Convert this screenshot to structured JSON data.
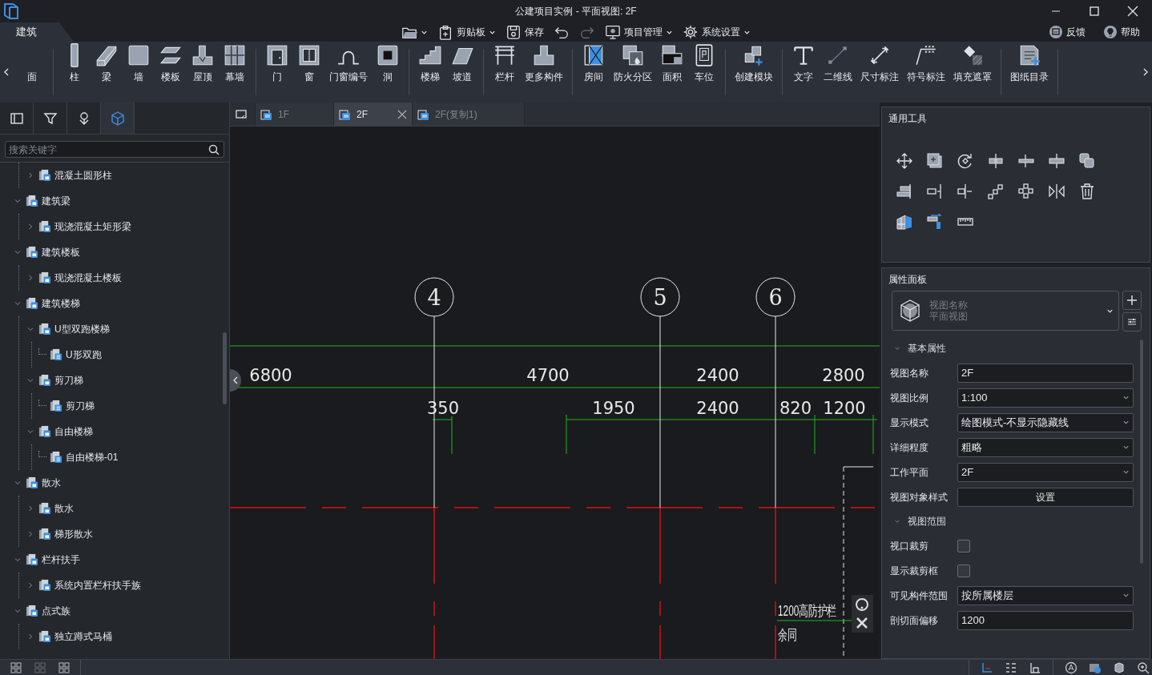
{
  "window": {
    "title": "公建项目实例 - 平面视图: 2F"
  },
  "ribbon_tabs": [
    {
      "label": "建筑",
      "selected": true
    }
  ],
  "quick_toolbar": [
    {
      "dropdown": true,
      "disabled": false
    },
    {
      "label": "剪贴板",
      "dropdown": true,
      "disabled": false
    },
    {
      "label": "保存",
      "dropdown": false,
      "disabled": false
    },
    {
      "dropdown": false,
      "disabled": false
    },
    {
      "dropdown": false,
      "disabled": true
    },
    {
      "label": "项目管理",
      "dropdown": true,
      "disabled": false
    },
    {
      "label": "系统设置",
      "dropdown": true,
      "disabled": false
    }
  ],
  "help_links": [
    "反馈",
    "帮助"
  ],
  "ribbon": [
    {
      "tools": [
        "面"
      ]
    },
    {
      "tools": [
        "柱",
        "梁",
        "墙",
        "楼板",
        "屋顶",
        "幕墙"
      ]
    },
    {
      "tools": [
        "门",
        "窗",
        "门窗编号",
        "洞"
      ]
    },
    {
      "tools": [
        "楼梯",
        "坡道"
      ]
    },
    {
      "tools": [
        "栏杆",
        "更多构件"
      ]
    },
    {
      "tools": [
        "房间",
        "防火分区",
        "面积",
        "车位"
      ]
    },
    {
      "tools": [
        "创建模块"
      ]
    },
    {
      "tools": [
        "文字",
        "二维线",
        "尺寸标注",
        "符号标注",
        "填充遮罩"
      ]
    },
    {
      "tools": [
        "图纸目录"
      ]
    }
  ],
  "left_panel": {
    "tabs": [
      {
        "selected": false
      },
      {
        "selected": false
      },
      {
        "selected": false
      },
      {
        "selected": true
      }
    ],
    "search": {
      "placeholder": "搜索关键字"
    },
    "tree": [
      {
        "children": [
          {
            "label": "混凝土圆形柱",
            "expanded": false
          }
        ]
      },
      {
        "label": "建筑梁",
        "expanded": true,
        "children": [
          {
            "label": "现浇混凝土矩形梁",
            "expanded": false
          }
        ]
      },
      {
        "label": "建筑楼板",
        "expanded": true,
        "children": [
          {
            "label": "现浇混凝土楼板",
            "expanded": false
          }
        ]
      },
      {
        "label": "建筑楼梯",
        "expanded": true,
        "children": [
          {
            "label": "U型双跑楼梯",
            "expanded": true,
            "children": [
              {
                "label": "U形双跑"
              }
            ]
          },
          {
            "label": "剪刀梯",
            "expanded": true,
            "children": [
              {
                "label": "剪刀梯"
              }
            ]
          },
          {
            "label": "自由楼梯",
            "expanded": true,
            "children": [
              {
                "label": "自由楼梯-01"
              }
            ]
          }
        ]
      },
      {
        "label": "散水",
        "expanded": true,
        "children": [
          {
            "label": "散水",
            "expanded": false
          },
          {
            "label": "梯形散水",
            "expanded": false
          }
        ]
      },
      {
        "label": "栏杆扶手",
        "expanded": true,
        "children": [
          {
            "label": "系统内置栏杆扶手族",
            "expanded": false
          }
        ]
      },
      {
        "label": "点式族",
        "expanded": true,
        "children": [
          {
            "label": "独立蹲式马桶",
            "expanded": false
          }
        ]
      }
    ]
  },
  "document_tabs": [
    {
      "label": "1F",
      "selected": false
    },
    {
      "label": "2F",
      "selected": true
    },
    {
      "label": "2F(复制1)",
      "selected": false
    }
  ],
  "drawing": {
    "grid_axes": [
      "4",
      "5",
      "6"
    ],
    "dimensions_upper": [
      "6800",
      "4700",
      "2400",
      "2800"
    ],
    "dimensions_lower": [
      "350",
      "1950",
      "2400",
      "820",
      "1200"
    ],
    "notes": [
      "1200高防护栏",
      "余同"
    ]
  },
  "tools_panel": {
    "title": "通用工具"
  },
  "properties": {
    "title": "属性面板",
    "view_selector": {
      "name": "视图名称",
      "type": "平面视图"
    },
    "sections": [
      {
        "title": "基本属性",
        "expanded": true,
        "rows": [
          {
            "label": "视图名称",
            "kind": "text",
            "value": "2F"
          },
          {
            "label": "视图比例",
            "kind": "select",
            "value": "1:100"
          },
          {
            "label": "显示模式",
            "kind": "select",
            "value": "绘图模式-不显示隐藏线"
          },
          {
            "label": "详细程度",
            "kind": "select",
            "value": "粗略"
          },
          {
            "label": "工作平面",
            "kind": "select",
            "value": "2F"
          },
          {
            "label": "视图对象样式",
            "kind": "button",
            "value": "设置"
          }
        ]
      },
      {
        "title": "视图范围",
        "expanded": true,
        "rows": [
          {
            "label": "视口裁剪",
            "kind": "checkbox",
            "checked": false
          },
          {
            "label": "显示裁剪框",
            "kind": "checkbox",
            "checked": false
          },
          {
            "label": "可见构件范围",
            "kind": "select",
            "value": "按所属楼层"
          },
          {
            "label": "剖切面偏移",
            "kind": "text",
            "value": "1200"
          }
        ]
      }
    ]
  }
}
